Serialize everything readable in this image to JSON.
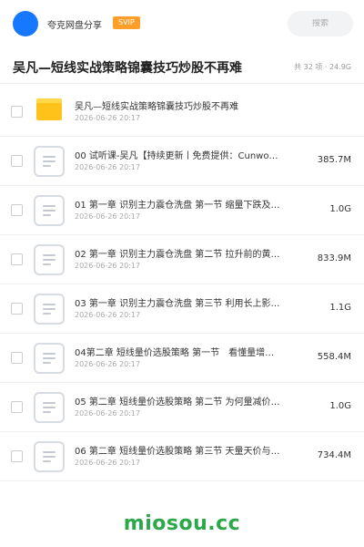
{
  "header": {
    "user_name": "夸克网盘分享",
    "badge": "SVIP",
    "search_placeholder": "搜索",
    "colors": {
      "avatar": "#1677ff",
      "badge": "#ff9f2a"
    }
  },
  "folder": {
    "title": "吴凡—短线实战策略锦囊技巧炒股不再难",
    "meta": "共 32 项 · 24.9G"
  },
  "files": [
    {
      "type": "folder",
      "name": "吴凡—短线实战策略锦囊技巧炒股不再难",
      "date": "2026-06-26 20:17",
      "size": ""
    },
    {
      "type": "doc",
      "name": "00 试听课-吴凡【持续更新丨免费提供：Cunwo…",
      "date": "2026-06-26 20:17",
      "size": "385.7M"
    },
    {
      "type": "doc",
      "name": "01 第一章 识别主力震仓洗盘 第一节 缩量下跌及…",
      "date": "2026-06-26 20:17",
      "size": "1.0G"
    },
    {
      "type": "doc",
      "name": "02 第一章 识别主力震仓洗盘 第二节 拉升前的黄…",
      "date": "2026-06-26 20:17",
      "size": "833.9M"
    },
    {
      "type": "doc",
      "name": "03 第一章 识别主力震仓洗盘 第三节 利用长上影…",
      "date": "2026-06-26 20:17",
      "size": "1.1G"
    },
    {
      "type": "doc",
      "name": "04第二章 短线量价选股策略 第一节　看懂量增…",
      "date": "2026-06-26 20:17",
      "size": "558.4M"
    },
    {
      "type": "doc",
      "name": "05 第二章 短线量价选股策略 第二节 为何量减价…",
      "date": "2026-06-26 20:17",
      "size": "1.0G"
    },
    {
      "type": "doc",
      "name": "06 第二章 短线量价选股策略 第三节 天量天价与…",
      "date": "2026-06-26 20:17",
      "size": "734.4M"
    }
  ],
  "watermark": "miosou.cc",
  "colors": {
    "watermark": "#2ba84a",
    "folder_icon": "#ffc21a"
  }
}
